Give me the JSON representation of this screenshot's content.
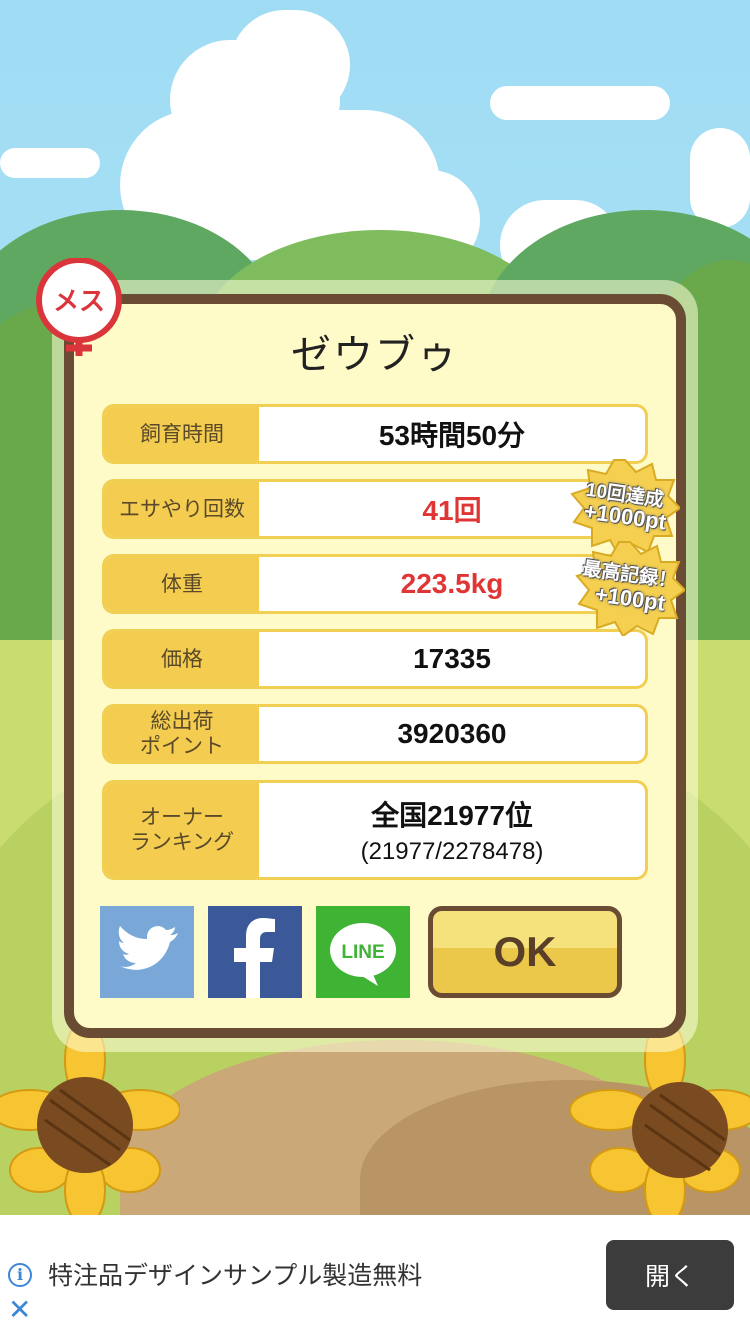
{
  "gender_badge": "メス",
  "pet_name": "ゼウブゥ",
  "stats": [
    {
      "label": "飼育時間",
      "value": "53時間50分",
      "sub": "",
      "highlight": false
    },
    {
      "label": "エサやり回数",
      "value": "41回",
      "sub": "",
      "highlight": true
    },
    {
      "label": "体重",
      "value": "223.5kg",
      "sub": "",
      "highlight": true
    },
    {
      "label": "価格",
      "value": "17335",
      "sub": "",
      "highlight": false
    },
    {
      "label": "総出荷\nポイント",
      "value": "3920360",
      "sub": "",
      "highlight": false
    },
    {
      "label": "オーナー\nランキング",
      "value": "全国21977位",
      "sub": "(21977/2278478)",
      "highlight": false
    }
  ],
  "stickers": [
    {
      "line1": "10回達成",
      "line2": "+1000pt"
    },
    {
      "line1": "最高記録！",
      "line2": "+100pt"
    }
  ],
  "share": {
    "twitter_icon": "twitter-bird-icon",
    "facebook_icon": "facebook-f-icon",
    "line_label": "LINE"
  },
  "ok_label": "OK",
  "ad": {
    "text": "特注品デザインサンプル製造無料",
    "button": "開く"
  },
  "colors": {
    "twitter": "#79a8d8",
    "facebook": "#3b5998",
    "line": "#3fb334",
    "frame": "#6a4b33",
    "label_bg": "#f3cc50",
    "highlight": "#e03535"
  }
}
